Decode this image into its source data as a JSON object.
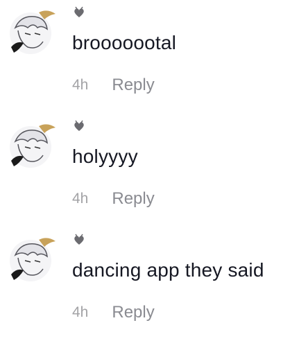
{
  "comments": [
    {
      "text": "brooooootal",
      "time": "4h",
      "reply_label": "Reply",
      "avatar_icon": "anime-character-avatar",
      "username_icon": "heart-badge-icon"
    },
    {
      "text": "holyyyy",
      "time": "4h",
      "reply_label": "Reply",
      "avatar_icon": "anime-character-avatar",
      "username_icon": "heart-badge-icon"
    },
    {
      "text": "dancing app they said",
      "time": "4h",
      "reply_label": "Reply",
      "avatar_icon": "anime-character-avatar",
      "username_icon": "heart-badge-icon"
    }
  ],
  "colors": {
    "text": "#161823",
    "timestamp": "#a3a3a6",
    "reply": "#8a8b91",
    "background": "#ffffff"
  }
}
